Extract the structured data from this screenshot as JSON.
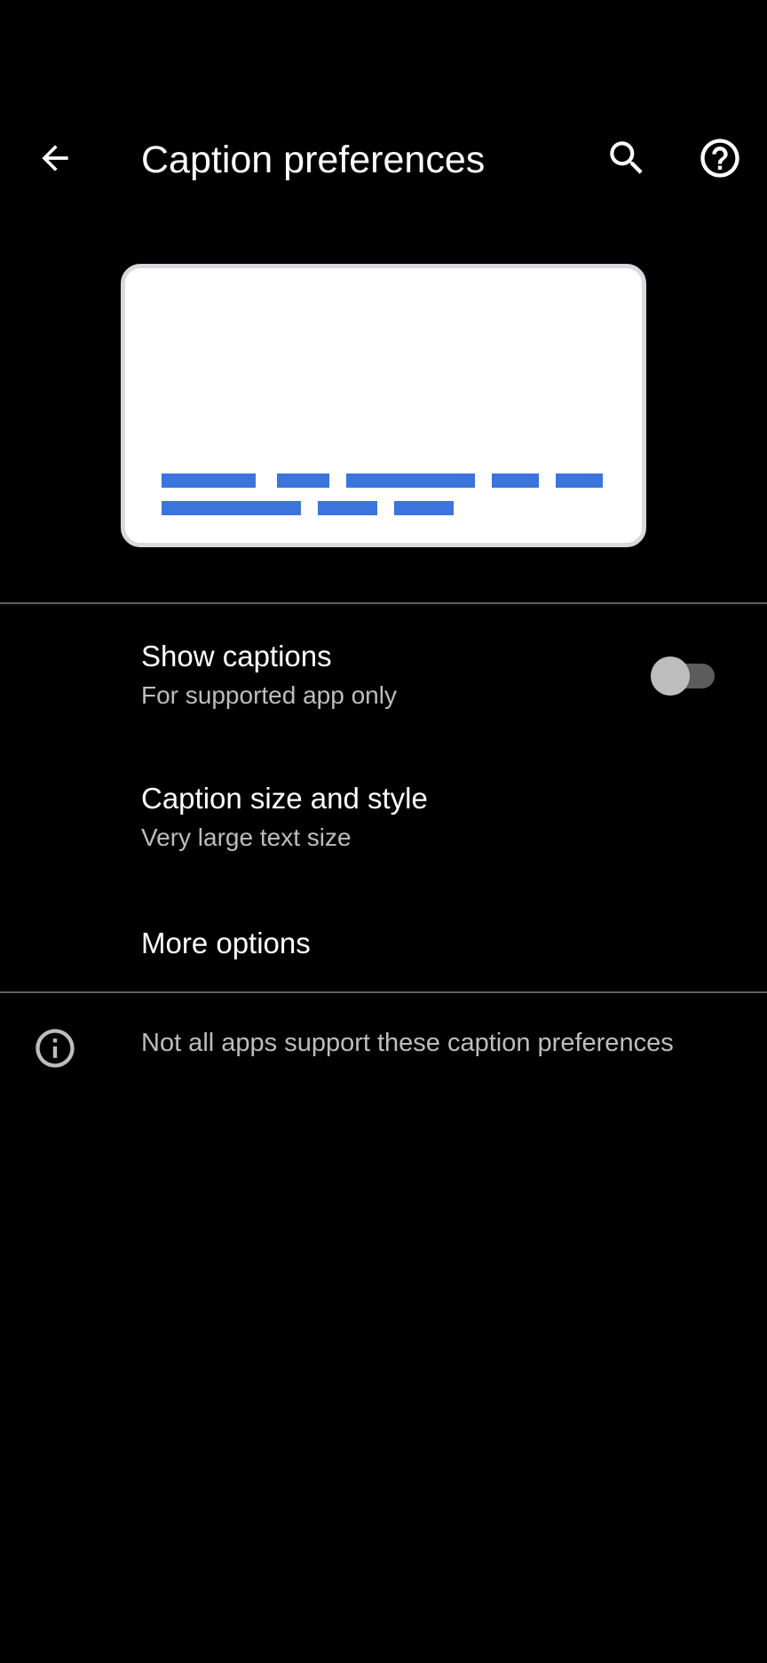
{
  "app_bar": {
    "title": "Caption preferences",
    "back_icon": "arrow-back-icon",
    "search_icon": "search-icon",
    "help_icon": "help-icon"
  },
  "preview": {
    "caption_color": "#3b74db"
  },
  "preferences": [
    {
      "title": "Show captions",
      "summary": "For supported app only",
      "toggle_on": false
    },
    {
      "title": "Caption size and style",
      "summary": "Very large text size"
    },
    {
      "title": "More options"
    }
  ],
  "footer": {
    "icon": "info-icon",
    "text": "Not all apps support these caption preferences"
  }
}
